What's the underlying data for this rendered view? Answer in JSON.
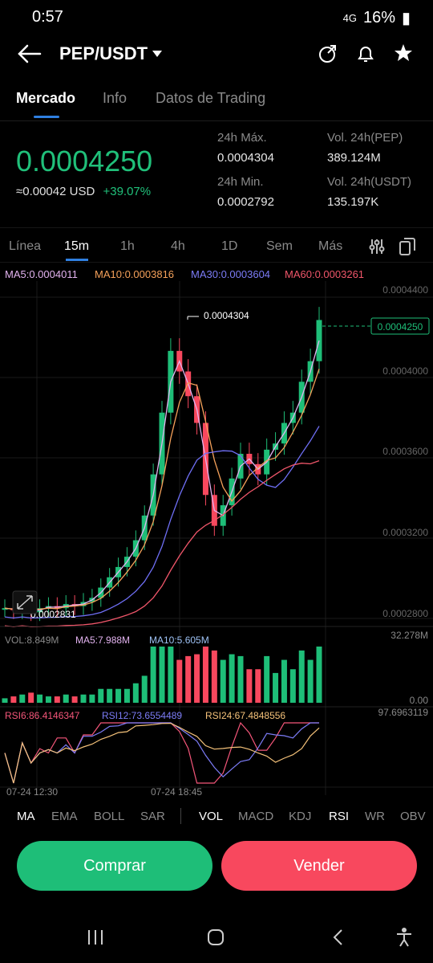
{
  "status": {
    "time": "0:57",
    "battery": "16%",
    "network": "4G"
  },
  "header": {
    "pair": "PEP/USDT"
  },
  "tabs": [
    "Mercado",
    "Info",
    "Datos de Trading"
  ],
  "price": {
    "last": "0.0004250",
    "approx": "≈0.00042 USD",
    "change": "+39.07%"
  },
  "stats": {
    "high_label": "24h Máx.",
    "high": "0.0004304",
    "low_label": "24h Min.",
    "low": "0.0002792",
    "vol_base_label": "Vol. 24h(PEP)",
    "vol_base": "389.124M",
    "vol_quote_label": "Vol. 24h(USDT)",
    "vol_quote": "135.197K"
  },
  "timeframes": [
    "Línea",
    "15m",
    "1h",
    "4h",
    "1D",
    "Sem",
    "Más"
  ],
  "ma": {
    "ma5": "MA5:0.0004011",
    "ma10": "MA10:0.0003816",
    "ma30": "MA30:0.0003604",
    "ma60": "MA60:0.0003261"
  },
  "chart_data": {
    "type": "candlestick",
    "pair": "PEP/USDT",
    "interval": "15m",
    "y_ticks": [
      "0.0004400",
      "0.0004000",
      "0.0003600",
      "0.0003200",
      "0.0002800"
    ],
    "ylim": [
      0.00028,
      0.00044
    ],
    "high_marker": "0.0004304",
    "low_marker": "0.0002831",
    "last_price_tag": "0.0004250",
    "x_ticks": [
      "07-24 12:30",
      "07-24 18:45"
    ],
    "close_series": [
      0.000285,
      0.000284,
      0.000286,
      0.000283,
      0.000285,
      0.000286,
      0.000285,
      0.000287,
      0.000286,
      0.000288,
      0.00029,
      0.000295,
      0.0003,
      0.000305,
      0.00031,
      0.000318,
      0.00033,
      0.00035,
      0.00038,
      0.00041,
      0.0004,
      0.000388,
      0.000375,
      0.00034,
      0.000325,
      0.000335,
      0.000348,
      0.00036,
      0.000355,
      0.00035,
      0.000362,
      0.000365,
      0.000375,
      0.00038,
      0.000395,
      0.000405,
      0.000425
    ],
    "ma_series": [
      {
        "name": "MA5",
        "color": "#e3b3f0"
      },
      {
        "name": "MA10",
        "color": "#f5a15a"
      },
      {
        "name": "MA30",
        "color": "#6f6ff5"
      },
      {
        "name": "MA60",
        "color": "#f0566a"
      }
    ]
  },
  "volume": {
    "vol": "VOL:8.849M",
    "ma5": "MA5:7.988M",
    "ma10": "MA10:5.605M",
    "max": "32.278M",
    "min": "0.00"
  },
  "rsi": {
    "rsi6": "RSI6:86.4146347",
    "rsi12": "RSI12:73.6554489",
    "rsi24": "RSI24:67.4848556",
    "max": "97.6963119"
  },
  "indicators": [
    "MA",
    "EMA",
    "BOLL",
    "SAR",
    "VOL",
    "MACD",
    "KDJ",
    "RSI",
    "WR",
    "OBV"
  ],
  "actions": {
    "buy": "Comprar",
    "sell": "Vender"
  },
  "colors": {
    "up": "#1ebe78",
    "down": "#f8485e",
    "accent": "#2f7fe0"
  }
}
